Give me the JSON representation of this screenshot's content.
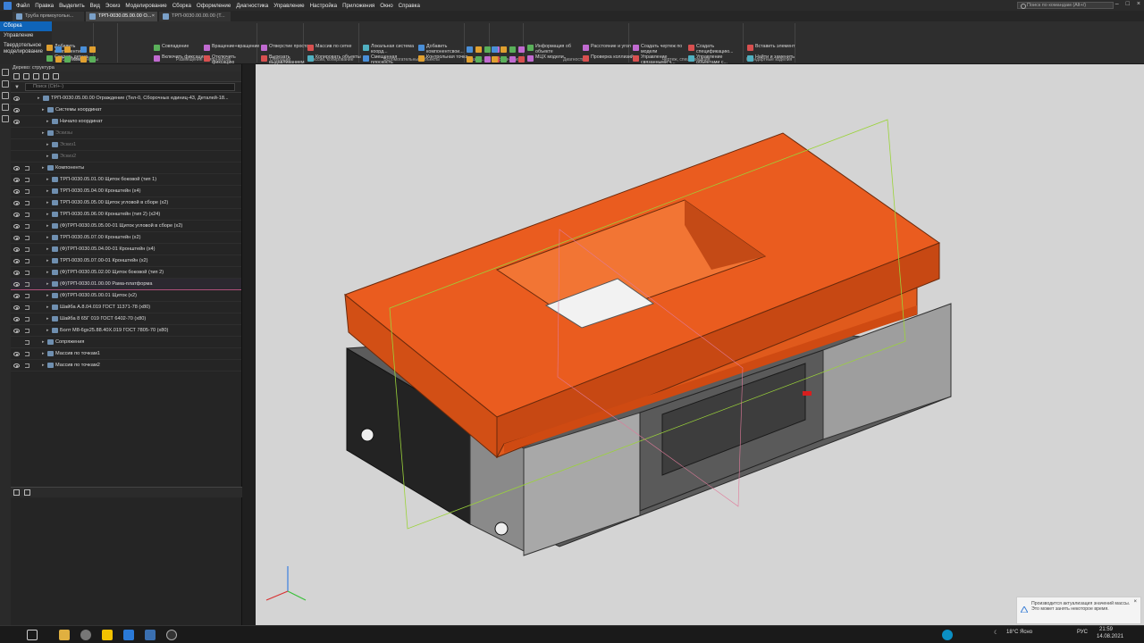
{
  "menu": {
    "items": [
      "Файл",
      "Правка",
      "Выделить",
      "Вид",
      "Эскиз",
      "Моделирование",
      "Сборка",
      "Оформление",
      "Диагностика",
      "Управление",
      "Настройка",
      "Приложения",
      "Окно",
      "Справка"
    ],
    "search_placeholder": "Поиск по командам (Alt+/)"
  },
  "tabs": [
    {
      "label": "Труба прямоугольн..."
    },
    {
      "label": "ТРП-0030.05.00.00 О..."
    },
    {
      "label": "ТРП-0030.00.00.00 (Т..."
    }
  ],
  "modes": [
    "Сборка",
    "Управление",
    "Твердотельное моделирование"
  ],
  "ribbon": {
    "g1": {
      "buttons": [
        "Добавить компонентиз...",
        "Создать деталь",
        "Зеркальное отражение ко..."
      ],
      "label": "Компоненты"
    },
    "g0": {
      "label": "Системная"
    },
    "g2": {
      "buttons": [
        "Совпадение",
        "Включить фиксацию",
        "Переместить компонент"
      ],
      "label": "Размещение компонентов"
    },
    "g2b": {
      "buttons": [
        "Вращение+вращение",
        "Отключить фиксацию"
      ]
    },
    "g3": {
      "buttons": [
        "Отверстие простое",
        "Вырезать выдавливанием",
        "Сечение"
      ],
      "label": "Операции"
    },
    "g4": {
      "buttons": [
        "Массив по сетке",
        "Копировать объекты",
        "Коллекция геометрии"
      ],
      "label": "Массив, копирование"
    },
    "g5": {
      "buttons": [
        "Локальная система коорд...",
        "Смещенная плоскость",
        "Ось через две вершины"
      ],
      "label": "Вспомогательные объекты"
    },
    "g5b": {
      "buttons": [
        "Добавить компонентсвои...",
        "Контрольная точка"
      ]
    },
    "g6": {
      "label": "Разме..."
    },
    "g7": {
      "label": "Обозначения"
    },
    "g8": {
      "buttons": [
        "Информация об объекте",
        "МЦХ модели",
        "График кривизны"
      ],
      "label": "Диагностика"
    },
    "g8b": {
      "buttons": [
        "Расстояние и угол",
        "Проверка коллизий",
        "Проверка непрерывности"
      ]
    },
    "g9": {
      "buttons": [
        "Создать чертеж по модели",
        "Управление связанными ч..."
      ],
      "label": "Чертеж, спецификация"
    },
    "g9b": {
      "buttons": [
        "Создать спецификацию...",
        "Управление объектами с..."
      ]
    },
    "g10": {
      "buttons": [
        "Вставить элемент",
        "Найти и заменить",
        "Обновить ссылки на мод..."
      ],
      "label": "Стандартные изделия"
    }
  },
  "panel": {
    "title": "Дерево: структура",
    "search_placeholder": "Поиск (Ctrl+-)"
  },
  "tree": [
    {
      "label": "ТРП-0030.05.00.00 Ограждение (Тел-0, Сборочных единиц-43, Деталей-18...",
      "indent": 0,
      "eye": true,
      "vis": false,
      "dim": false
    },
    {
      "label": "Системы координат",
      "indent": 1,
      "eye": true,
      "vis": false,
      "dim": false
    },
    {
      "label": "Начало координат",
      "indent": 2,
      "eye": true,
      "vis": false,
      "dim": false
    },
    {
      "label": "Эскизы",
      "indent": 1,
      "eye": false,
      "vis": false,
      "dim": true
    },
    {
      "label": "Эскиз1",
      "indent": 2,
      "eye": false,
      "vis": false,
      "dim": true
    },
    {
      "label": "Эскиз2",
      "indent": 2,
      "eye": false,
      "vis": false,
      "dim": true
    },
    {
      "label": "Компоненты",
      "indent": 1,
      "eye": true,
      "vis": true,
      "dim": false
    },
    {
      "label": "ТРП-0030.05.01.00 Щиток боковой (тип 1)",
      "indent": 2,
      "eye": true,
      "vis": true,
      "dim": false
    },
    {
      "label": "ТРП-0030.05.04.00 Кронштейн (x4)",
      "indent": 2,
      "eye": true,
      "vis": true,
      "dim": false
    },
    {
      "label": "ТРП-0030.05.05.00 Щиток угловой в сборе (x2)",
      "indent": 2,
      "eye": true,
      "vis": true,
      "dim": false
    },
    {
      "label": "ТРП-0030.05.06.00 Кронштейн (тип 2) (x24)",
      "indent": 2,
      "eye": true,
      "vis": true,
      "dim": false
    },
    {
      "label": "(Ф)ТРП-0030.05.05.00-01 Щиток угловой в сборе (x2)",
      "indent": 2,
      "eye": true,
      "vis": true,
      "dim": false
    },
    {
      "label": "ТРП-0030.05.07.00 Кронштейн (x2)",
      "indent": 2,
      "eye": true,
      "vis": true,
      "dim": false
    },
    {
      "label": "(Ф)ТРП-0030.05.04.00-01 Кронштейн (x4)",
      "indent": 2,
      "eye": true,
      "vis": true,
      "dim": false
    },
    {
      "label": "ТРП-0030.05.07.00-01 Кронштейн (x2)",
      "indent": 2,
      "eye": true,
      "vis": true,
      "dim": false
    },
    {
      "label": "(Ф)ТРП-0030.05.02.00 Щиток боковой (тип 2)",
      "indent": 2,
      "eye": true,
      "vis": true,
      "dim": false
    },
    {
      "label": "(Ф)ТРП-0030.01.00.00 Рама-платформа",
      "indent": 2,
      "eye": true,
      "vis": true,
      "dim": false,
      "selected": true
    },
    {
      "label": "(Ф)ТРП-0030.05.00.01 Щиток (x2)",
      "indent": 2,
      "eye": true,
      "vis": true,
      "dim": false
    },
    {
      "label": "Шайба А.8.04.019 ГОСТ 11371-78 (x80)",
      "indent": 2,
      "eye": true,
      "vis": true,
      "dim": false
    },
    {
      "label": "Шайба 8 65Г 019 ГОСТ 6402-70 (x80)",
      "indent": 2,
      "eye": true,
      "vis": true,
      "dim": false
    },
    {
      "label": "Болт М8-6gх25.88.40Х.019 ГОСТ 7805-70 (x80)",
      "indent": 2,
      "eye": true,
      "vis": true,
      "dim": false
    },
    {
      "label": "Сопряжения",
      "indent": 1,
      "eye": false,
      "vis": true,
      "dim": false
    },
    {
      "label": "Массив по точкам1",
      "indent": 1,
      "eye": true,
      "vis": true,
      "dim": false
    },
    {
      "label": "Массив по точкам2",
      "indent": 1,
      "eye": true,
      "vis": true,
      "dim": false
    }
  ],
  "notification": {
    "text": "Производится актуализация значений массы. Это может занять некоторое время."
  },
  "taskbar": {
    "weather": "18°C Ясно",
    "lang": "РУС",
    "time": "21:59",
    "date": "14.08.2021"
  },
  "colors": {
    "accent": "#0f64b8",
    "model_orange": "#e0571c",
    "model_gray": "#6a6a6a",
    "viewport_bg": "#d4d4d4"
  }
}
